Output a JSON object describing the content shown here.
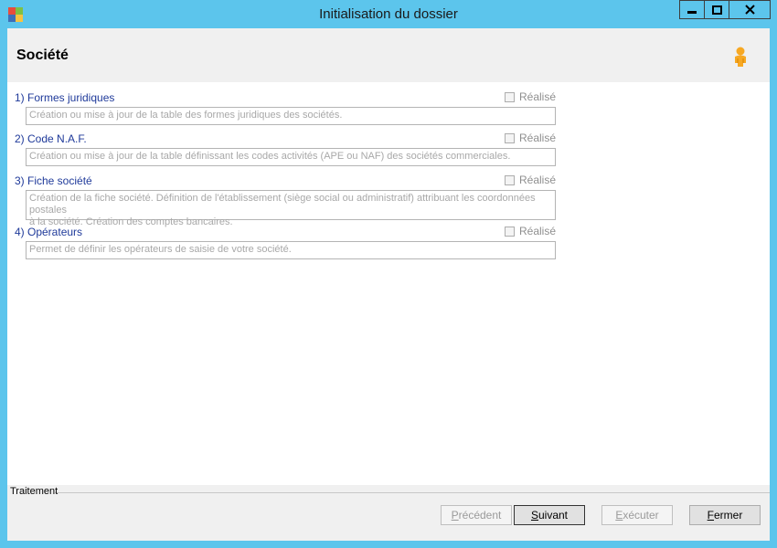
{
  "window": {
    "title": "Initialisation du dossier"
  },
  "header": {
    "title": "Société"
  },
  "sections": [
    {
      "label": "1) Formes juridiques",
      "checkbox_label": "Réalisé",
      "description": "Création ou mise à jour de la table des formes juridiques des sociétés."
    },
    {
      "label": "2) Code N.A.F.",
      "checkbox_label": "Réalisé",
      "description": "Création ou mise à jour de la table définissant les codes activités (APE ou NAF) des sociétés commerciales."
    },
    {
      "label": "3) Fiche société",
      "checkbox_label": "Réalisé",
      "description_line1": "Création de la fiche société. Définition de l'établissement (siège social ou administratif) attribuant les coordonnées postales",
      "description_line2": "à la société. Création des comptes bancaires."
    },
    {
      "label": "4) Opérateurs",
      "checkbox_label": "Réalisé",
      "description": "Permet de définir les opérateurs de saisie de votre société."
    }
  ],
  "footer": {
    "group_label": "Traitement",
    "buttons": {
      "previous": {
        "first": "P",
        "rest": "récédent"
      },
      "next": {
        "first": "S",
        "rest": "uivant"
      },
      "execute": {
        "first": "E",
        "rest": "xécuter"
      },
      "close": {
        "first": "F",
        "rest": "ermer"
      }
    }
  },
  "colors": {
    "frame": "#5cc5ec",
    "section_label": "#1f3a9a"
  },
  "icons": {
    "app": "app-icon",
    "user": "user-icon"
  }
}
